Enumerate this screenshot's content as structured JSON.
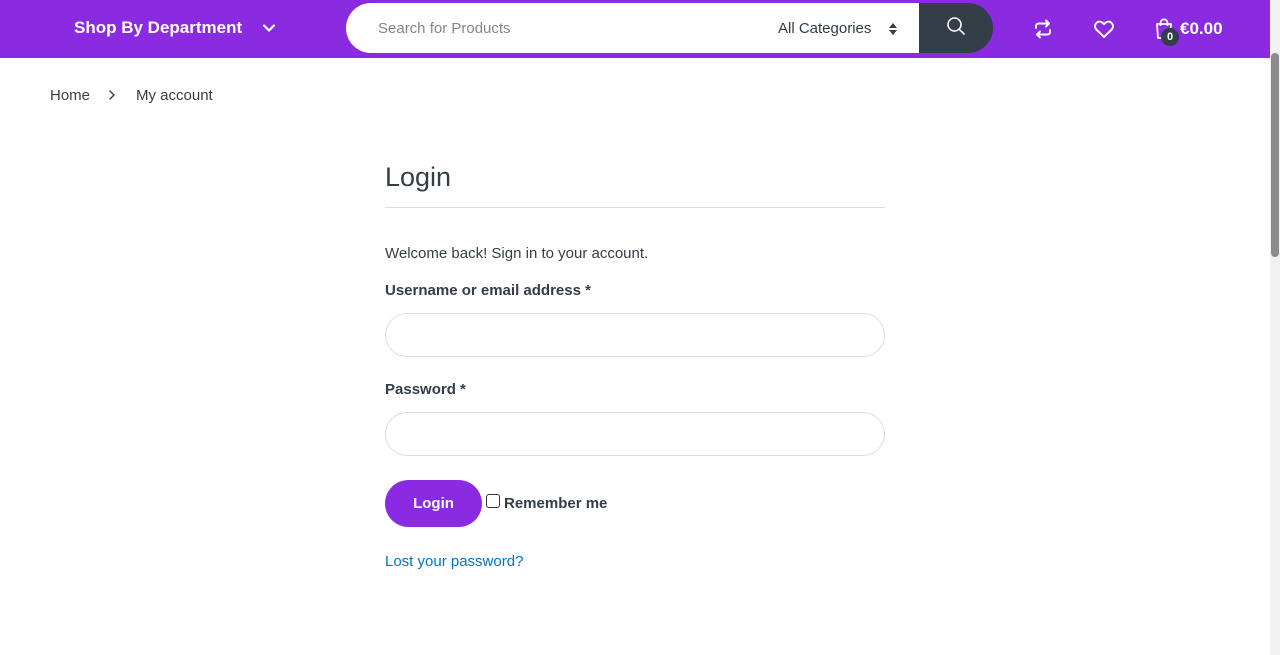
{
  "header": {
    "department_label": "Shop By Department",
    "search": {
      "placeholder": "Search for Products",
      "category": "All Categories"
    },
    "cart": {
      "count": "0",
      "amount": "€0.00"
    },
    "icons": {
      "compare": "compare-icon",
      "wishlist": "heart-icon",
      "cart": "bag-icon",
      "search": "search-icon"
    }
  },
  "breadcrumb": {
    "home": "Home",
    "current": "My account"
  },
  "login": {
    "title": "Login",
    "welcome": "Welcome back! Sign in to your account.",
    "username_label": "Username or email address *",
    "password_label": "Password *",
    "submit_label": "Login",
    "remember_label": "Remember me",
    "lost_password": "Lost your password?"
  },
  "colors": {
    "brand": "#8a2be2",
    "dark": "#333e48",
    "link": "#0073c4"
  }
}
